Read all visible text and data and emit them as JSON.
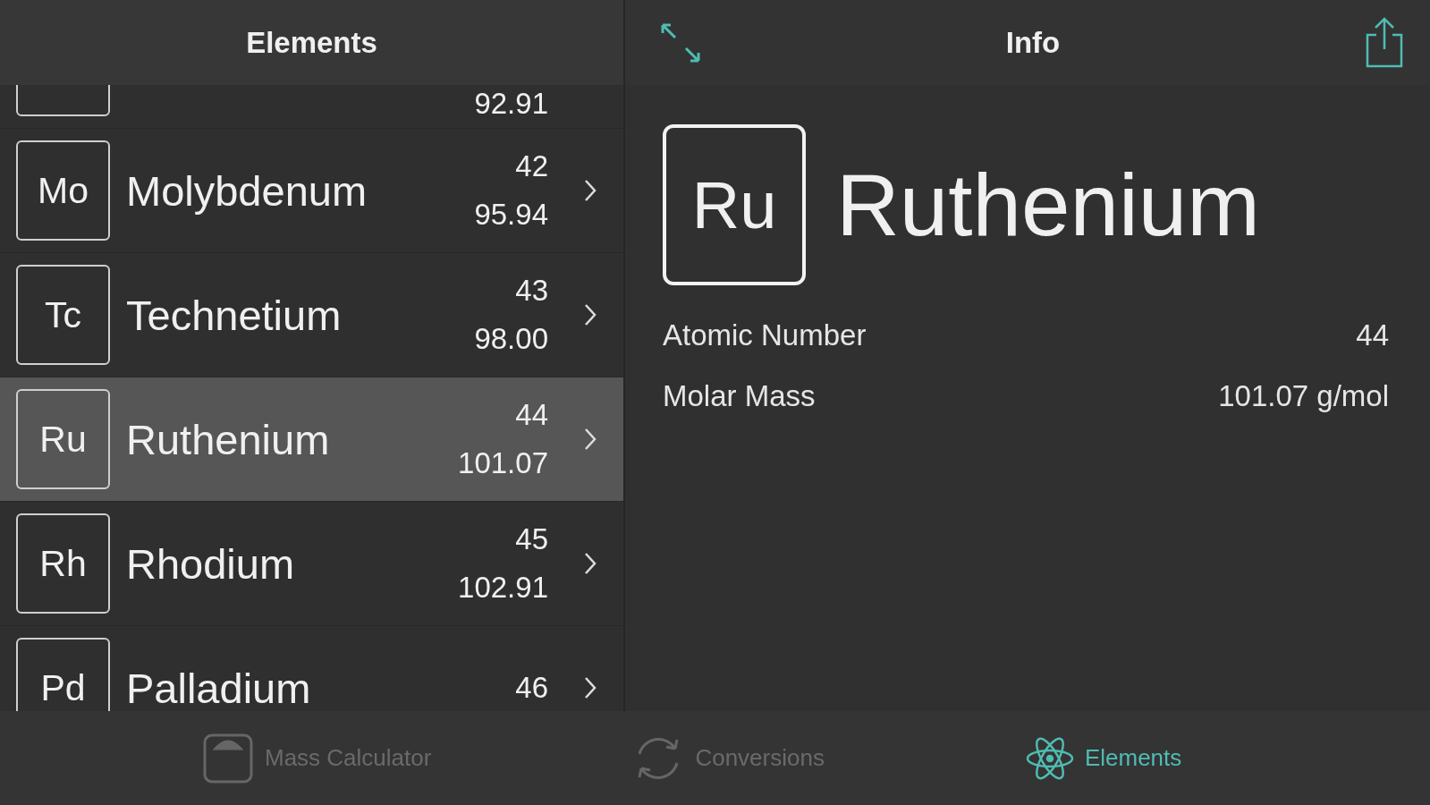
{
  "list_header": {
    "title": "Elements"
  },
  "elements": [
    {
      "mass": "92.91",
      "selected": false
    },
    {
      "symbol": "Mo",
      "name": "Molybdenum",
      "number": "42",
      "mass": "95.94",
      "selected": false
    },
    {
      "symbol": "Tc",
      "name": "Technetium",
      "number": "43",
      "mass": "98.00",
      "selected": false
    },
    {
      "symbol": "Ru",
      "name": "Ruthenium",
      "number": "44",
      "mass": "101.07",
      "selected": true
    },
    {
      "symbol": "Rh",
      "name": "Rhodium",
      "number": "45",
      "mass": "102.91",
      "selected": false
    },
    {
      "symbol": "Pd",
      "name": "Palladium",
      "number": "46",
      "selected": false
    }
  ],
  "detail_header": {
    "title": "Info"
  },
  "detail": {
    "symbol": "Ru",
    "name": "Ruthenium",
    "properties": [
      {
        "label": "Atomic Number",
        "value": "44"
      },
      {
        "label": "Molar Mass",
        "value": "101.07 g/mol"
      }
    ]
  },
  "tab_bar": [
    {
      "kind": "scale",
      "label": "Mass Calculator",
      "selected": false
    },
    {
      "kind": "convert",
      "label": "Conversions",
      "selected": false
    },
    {
      "kind": "atom",
      "label": "Elements",
      "selected": true
    }
  ]
}
